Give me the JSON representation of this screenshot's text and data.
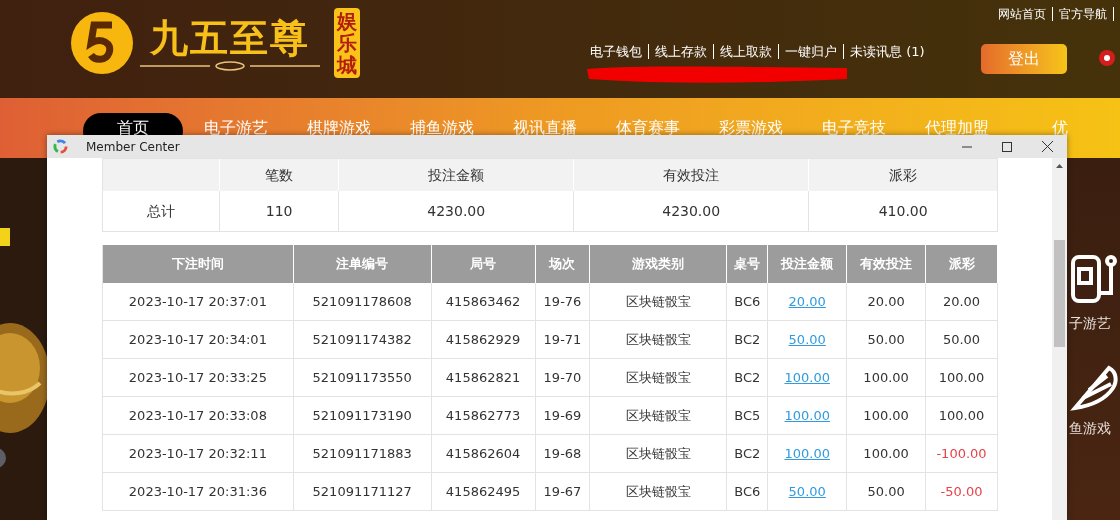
{
  "site": {
    "logo_text": "九五至尊",
    "logo_badge": "娱乐城",
    "top_links": [
      "网站首页",
      "官方导航"
    ],
    "account_links": [
      "电子钱包",
      "线上存款",
      "线上取款",
      "一键归户",
      "未读讯息 (1)"
    ],
    "logout": "登出"
  },
  "nav": [
    {
      "label": "首页",
      "selected": true
    },
    {
      "label": "电子游艺",
      "selected": false
    },
    {
      "label": "棋牌游戏",
      "selected": false
    },
    {
      "label": "捕鱼游戏",
      "selected": false
    },
    {
      "label": "视讯直播",
      "selected": false
    },
    {
      "label": "体育赛事",
      "selected": false
    },
    {
      "label": "彩票游戏",
      "selected": false
    },
    {
      "label": "电子竞技",
      "selected": false
    },
    {
      "label": "代理加盟",
      "selected": false
    },
    {
      "label": "优",
      "selected": false
    }
  ],
  "side_items": [
    {
      "label": "子游艺",
      "kind": "slot"
    },
    {
      "label": "鱼游戏",
      "kind": "fish"
    }
  ],
  "window": {
    "title": "Member Center"
  },
  "summary": {
    "columns": [
      "笔数",
      "投注金额",
      "有效投注",
      "派彩"
    ],
    "row_label": "总计",
    "values": [
      "110",
      "4230.00",
      "4230.00",
      "410.00"
    ]
  },
  "bets": {
    "columns": [
      "下注时间",
      "注单编号",
      "局号",
      "场次",
      "游戏类别",
      "桌号",
      "投注金额",
      "有效投注",
      "派彩"
    ],
    "rows": [
      {
        "cells": [
          "2023-10-17 20:37:01",
          "521091178608",
          "415863462",
          "19-76",
          "区块链骰宝",
          "BC6",
          "20.00",
          "20.00",
          "20.00"
        ],
        "loss": false
      },
      {
        "cells": [
          "2023-10-17 20:34:01",
          "521091174382",
          "415862929",
          "19-71",
          "区块链骰宝",
          "BC2",
          "50.00",
          "50.00",
          "50.00"
        ],
        "loss": false
      },
      {
        "cells": [
          "2023-10-17 20:33:25",
          "521091173550",
          "415862821",
          "19-70",
          "区块链骰宝",
          "BC2",
          "100.00",
          "100.00",
          "100.00"
        ],
        "loss": false
      },
      {
        "cells": [
          "2023-10-17 20:33:08",
          "521091173190",
          "415862773",
          "19-69",
          "区块链骰宝",
          "BC5",
          "100.00",
          "100.00",
          "100.00"
        ],
        "loss": false
      },
      {
        "cells": [
          "2023-10-17 20:32:11",
          "521091171883",
          "415862604",
          "19-68",
          "区块链骰宝",
          "BC2",
          "100.00",
          "100.00",
          "-100.00"
        ],
        "loss": true
      },
      {
        "cells": [
          "2023-10-17 20:31:36",
          "521091171127",
          "415862495",
          "19-67",
          "区块链骰宝",
          "BC6",
          "50.00",
          "50.00",
          "-50.00"
        ],
        "loss": true
      }
    ]
  }
}
